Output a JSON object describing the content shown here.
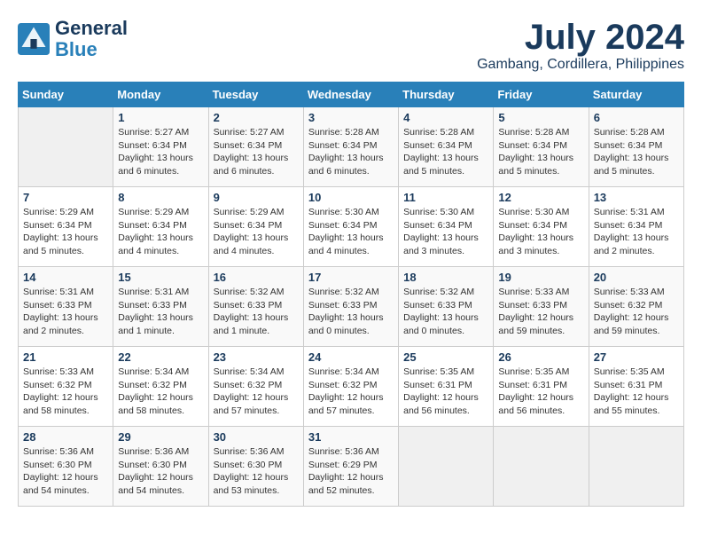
{
  "header": {
    "logo_line1": "General",
    "logo_line2": "Blue",
    "month": "July 2024",
    "location": "Gambang, Cordillera, Philippines"
  },
  "days_of_week": [
    "Sunday",
    "Monday",
    "Tuesday",
    "Wednesday",
    "Thursday",
    "Friday",
    "Saturday"
  ],
  "weeks": [
    [
      {
        "day": "",
        "info": ""
      },
      {
        "day": "1",
        "info": "Sunrise: 5:27 AM\nSunset: 6:34 PM\nDaylight: 13 hours\nand 6 minutes."
      },
      {
        "day": "2",
        "info": "Sunrise: 5:27 AM\nSunset: 6:34 PM\nDaylight: 13 hours\nand 6 minutes."
      },
      {
        "day": "3",
        "info": "Sunrise: 5:28 AM\nSunset: 6:34 PM\nDaylight: 13 hours\nand 6 minutes."
      },
      {
        "day": "4",
        "info": "Sunrise: 5:28 AM\nSunset: 6:34 PM\nDaylight: 13 hours\nand 5 minutes."
      },
      {
        "day": "5",
        "info": "Sunrise: 5:28 AM\nSunset: 6:34 PM\nDaylight: 13 hours\nand 5 minutes."
      },
      {
        "day": "6",
        "info": "Sunrise: 5:28 AM\nSunset: 6:34 PM\nDaylight: 13 hours\nand 5 minutes."
      }
    ],
    [
      {
        "day": "7",
        "info": "Sunrise: 5:29 AM\nSunset: 6:34 PM\nDaylight: 13 hours\nand 5 minutes."
      },
      {
        "day": "8",
        "info": "Sunrise: 5:29 AM\nSunset: 6:34 PM\nDaylight: 13 hours\nand 4 minutes."
      },
      {
        "day": "9",
        "info": "Sunrise: 5:29 AM\nSunset: 6:34 PM\nDaylight: 13 hours\nand 4 minutes."
      },
      {
        "day": "10",
        "info": "Sunrise: 5:30 AM\nSunset: 6:34 PM\nDaylight: 13 hours\nand 4 minutes."
      },
      {
        "day": "11",
        "info": "Sunrise: 5:30 AM\nSunset: 6:34 PM\nDaylight: 13 hours\nand 3 minutes."
      },
      {
        "day": "12",
        "info": "Sunrise: 5:30 AM\nSunset: 6:34 PM\nDaylight: 13 hours\nand 3 minutes."
      },
      {
        "day": "13",
        "info": "Sunrise: 5:31 AM\nSunset: 6:34 PM\nDaylight: 13 hours\nand 2 minutes."
      }
    ],
    [
      {
        "day": "14",
        "info": "Sunrise: 5:31 AM\nSunset: 6:33 PM\nDaylight: 13 hours\nand 2 minutes."
      },
      {
        "day": "15",
        "info": "Sunrise: 5:31 AM\nSunset: 6:33 PM\nDaylight: 13 hours\nand 1 minute."
      },
      {
        "day": "16",
        "info": "Sunrise: 5:32 AM\nSunset: 6:33 PM\nDaylight: 13 hours\nand 1 minute."
      },
      {
        "day": "17",
        "info": "Sunrise: 5:32 AM\nSunset: 6:33 PM\nDaylight: 13 hours\nand 0 minutes."
      },
      {
        "day": "18",
        "info": "Sunrise: 5:32 AM\nSunset: 6:33 PM\nDaylight: 13 hours\nand 0 minutes."
      },
      {
        "day": "19",
        "info": "Sunrise: 5:33 AM\nSunset: 6:33 PM\nDaylight: 12 hours\nand 59 minutes."
      },
      {
        "day": "20",
        "info": "Sunrise: 5:33 AM\nSunset: 6:32 PM\nDaylight: 12 hours\nand 59 minutes."
      }
    ],
    [
      {
        "day": "21",
        "info": "Sunrise: 5:33 AM\nSunset: 6:32 PM\nDaylight: 12 hours\nand 58 minutes."
      },
      {
        "day": "22",
        "info": "Sunrise: 5:34 AM\nSunset: 6:32 PM\nDaylight: 12 hours\nand 58 minutes."
      },
      {
        "day": "23",
        "info": "Sunrise: 5:34 AM\nSunset: 6:32 PM\nDaylight: 12 hours\nand 57 minutes."
      },
      {
        "day": "24",
        "info": "Sunrise: 5:34 AM\nSunset: 6:32 PM\nDaylight: 12 hours\nand 57 minutes."
      },
      {
        "day": "25",
        "info": "Sunrise: 5:35 AM\nSunset: 6:31 PM\nDaylight: 12 hours\nand 56 minutes."
      },
      {
        "day": "26",
        "info": "Sunrise: 5:35 AM\nSunset: 6:31 PM\nDaylight: 12 hours\nand 56 minutes."
      },
      {
        "day": "27",
        "info": "Sunrise: 5:35 AM\nSunset: 6:31 PM\nDaylight: 12 hours\nand 55 minutes."
      }
    ],
    [
      {
        "day": "28",
        "info": "Sunrise: 5:36 AM\nSunset: 6:30 PM\nDaylight: 12 hours\nand 54 minutes."
      },
      {
        "day": "29",
        "info": "Sunrise: 5:36 AM\nSunset: 6:30 PM\nDaylight: 12 hours\nand 54 minutes."
      },
      {
        "day": "30",
        "info": "Sunrise: 5:36 AM\nSunset: 6:30 PM\nDaylight: 12 hours\nand 53 minutes."
      },
      {
        "day": "31",
        "info": "Sunrise: 5:36 AM\nSunset: 6:29 PM\nDaylight: 12 hours\nand 52 minutes."
      },
      {
        "day": "",
        "info": ""
      },
      {
        "day": "",
        "info": ""
      },
      {
        "day": "",
        "info": ""
      }
    ]
  ]
}
